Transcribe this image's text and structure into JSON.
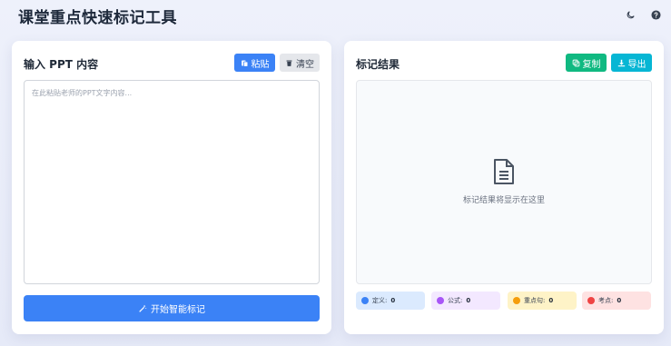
{
  "app": {
    "title": "课堂重点快速标记工具"
  },
  "top_icons": [
    "moon-icon",
    "help-icon"
  ],
  "input_panel": {
    "title": "输入 PPT 内容",
    "paste_label": "粘贴",
    "clear_label": "清空",
    "placeholder": "在此粘贴老师的PPT文字内容...",
    "value": "",
    "start_label": "开始智能标记"
  },
  "result_panel": {
    "title": "标记结果",
    "copy_label": "复制",
    "export_label": "导出",
    "empty_text": "标记结果将显示在这里"
  },
  "stats": [
    {
      "label": "定义:",
      "count": "0",
      "color": "#3b82f6"
    },
    {
      "label": "公式:",
      "count": "0",
      "color": "#a855f7"
    },
    {
      "label": "重点句:",
      "count": "0",
      "color": "#f59e0b"
    },
    {
      "label": "考点:",
      "count": "0",
      "color": "#ef4444"
    }
  ],
  "colors": {
    "primary": "#3b82f6",
    "success": "#10b981",
    "info": "#06b6d4"
  }
}
